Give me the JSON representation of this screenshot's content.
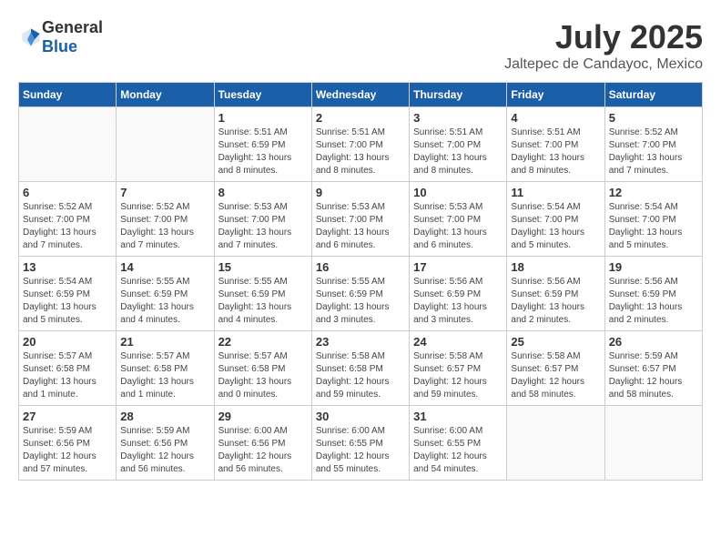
{
  "header": {
    "logo_general": "General",
    "logo_blue": "Blue",
    "month_year": "July 2025",
    "location": "Jaltepec de Candayoc, Mexico"
  },
  "weekdays": [
    "Sunday",
    "Monday",
    "Tuesday",
    "Wednesday",
    "Thursday",
    "Friday",
    "Saturday"
  ],
  "weeks": [
    [
      {
        "day": "",
        "info": ""
      },
      {
        "day": "",
        "info": ""
      },
      {
        "day": "1",
        "info": "Sunrise: 5:51 AM\nSunset: 6:59 PM\nDaylight: 13 hours\nand 8 minutes."
      },
      {
        "day": "2",
        "info": "Sunrise: 5:51 AM\nSunset: 7:00 PM\nDaylight: 13 hours\nand 8 minutes."
      },
      {
        "day": "3",
        "info": "Sunrise: 5:51 AM\nSunset: 7:00 PM\nDaylight: 13 hours\nand 8 minutes."
      },
      {
        "day": "4",
        "info": "Sunrise: 5:51 AM\nSunset: 7:00 PM\nDaylight: 13 hours\nand 8 minutes."
      },
      {
        "day": "5",
        "info": "Sunrise: 5:52 AM\nSunset: 7:00 PM\nDaylight: 13 hours\nand 7 minutes."
      }
    ],
    [
      {
        "day": "6",
        "info": "Sunrise: 5:52 AM\nSunset: 7:00 PM\nDaylight: 13 hours\nand 7 minutes."
      },
      {
        "day": "7",
        "info": "Sunrise: 5:52 AM\nSunset: 7:00 PM\nDaylight: 13 hours\nand 7 minutes."
      },
      {
        "day": "8",
        "info": "Sunrise: 5:53 AM\nSunset: 7:00 PM\nDaylight: 13 hours\nand 7 minutes."
      },
      {
        "day": "9",
        "info": "Sunrise: 5:53 AM\nSunset: 7:00 PM\nDaylight: 13 hours\nand 6 minutes."
      },
      {
        "day": "10",
        "info": "Sunrise: 5:53 AM\nSunset: 7:00 PM\nDaylight: 13 hours\nand 6 minutes."
      },
      {
        "day": "11",
        "info": "Sunrise: 5:54 AM\nSunset: 7:00 PM\nDaylight: 13 hours\nand 5 minutes."
      },
      {
        "day": "12",
        "info": "Sunrise: 5:54 AM\nSunset: 7:00 PM\nDaylight: 13 hours\nand 5 minutes."
      }
    ],
    [
      {
        "day": "13",
        "info": "Sunrise: 5:54 AM\nSunset: 6:59 PM\nDaylight: 13 hours\nand 5 minutes."
      },
      {
        "day": "14",
        "info": "Sunrise: 5:55 AM\nSunset: 6:59 PM\nDaylight: 13 hours\nand 4 minutes."
      },
      {
        "day": "15",
        "info": "Sunrise: 5:55 AM\nSunset: 6:59 PM\nDaylight: 13 hours\nand 4 minutes."
      },
      {
        "day": "16",
        "info": "Sunrise: 5:55 AM\nSunset: 6:59 PM\nDaylight: 13 hours\nand 3 minutes."
      },
      {
        "day": "17",
        "info": "Sunrise: 5:56 AM\nSunset: 6:59 PM\nDaylight: 13 hours\nand 3 minutes."
      },
      {
        "day": "18",
        "info": "Sunrise: 5:56 AM\nSunset: 6:59 PM\nDaylight: 13 hours\nand 2 minutes."
      },
      {
        "day": "19",
        "info": "Sunrise: 5:56 AM\nSunset: 6:59 PM\nDaylight: 13 hours\nand 2 minutes."
      }
    ],
    [
      {
        "day": "20",
        "info": "Sunrise: 5:57 AM\nSunset: 6:58 PM\nDaylight: 13 hours\nand 1 minute."
      },
      {
        "day": "21",
        "info": "Sunrise: 5:57 AM\nSunset: 6:58 PM\nDaylight: 13 hours\nand 1 minute."
      },
      {
        "day": "22",
        "info": "Sunrise: 5:57 AM\nSunset: 6:58 PM\nDaylight: 13 hours\nand 0 minutes."
      },
      {
        "day": "23",
        "info": "Sunrise: 5:58 AM\nSunset: 6:58 PM\nDaylight: 12 hours\nand 59 minutes."
      },
      {
        "day": "24",
        "info": "Sunrise: 5:58 AM\nSunset: 6:57 PM\nDaylight: 12 hours\nand 59 minutes."
      },
      {
        "day": "25",
        "info": "Sunrise: 5:58 AM\nSunset: 6:57 PM\nDaylight: 12 hours\nand 58 minutes."
      },
      {
        "day": "26",
        "info": "Sunrise: 5:59 AM\nSunset: 6:57 PM\nDaylight: 12 hours\nand 58 minutes."
      }
    ],
    [
      {
        "day": "27",
        "info": "Sunrise: 5:59 AM\nSunset: 6:56 PM\nDaylight: 12 hours\nand 57 minutes."
      },
      {
        "day": "28",
        "info": "Sunrise: 5:59 AM\nSunset: 6:56 PM\nDaylight: 12 hours\nand 56 minutes."
      },
      {
        "day": "29",
        "info": "Sunrise: 6:00 AM\nSunset: 6:56 PM\nDaylight: 12 hours\nand 56 minutes."
      },
      {
        "day": "30",
        "info": "Sunrise: 6:00 AM\nSunset: 6:55 PM\nDaylight: 12 hours\nand 55 minutes."
      },
      {
        "day": "31",
        "info": "Sunrise: 6:00 AM\nSunset: 6:55 PM\nDaylight: 12 hours\nand 54 minutes."
      },
      {
        "day": "",
        "info": ""
      },
      {
        "day": "",
        "info": ""
      }
    ]
  ]
}
